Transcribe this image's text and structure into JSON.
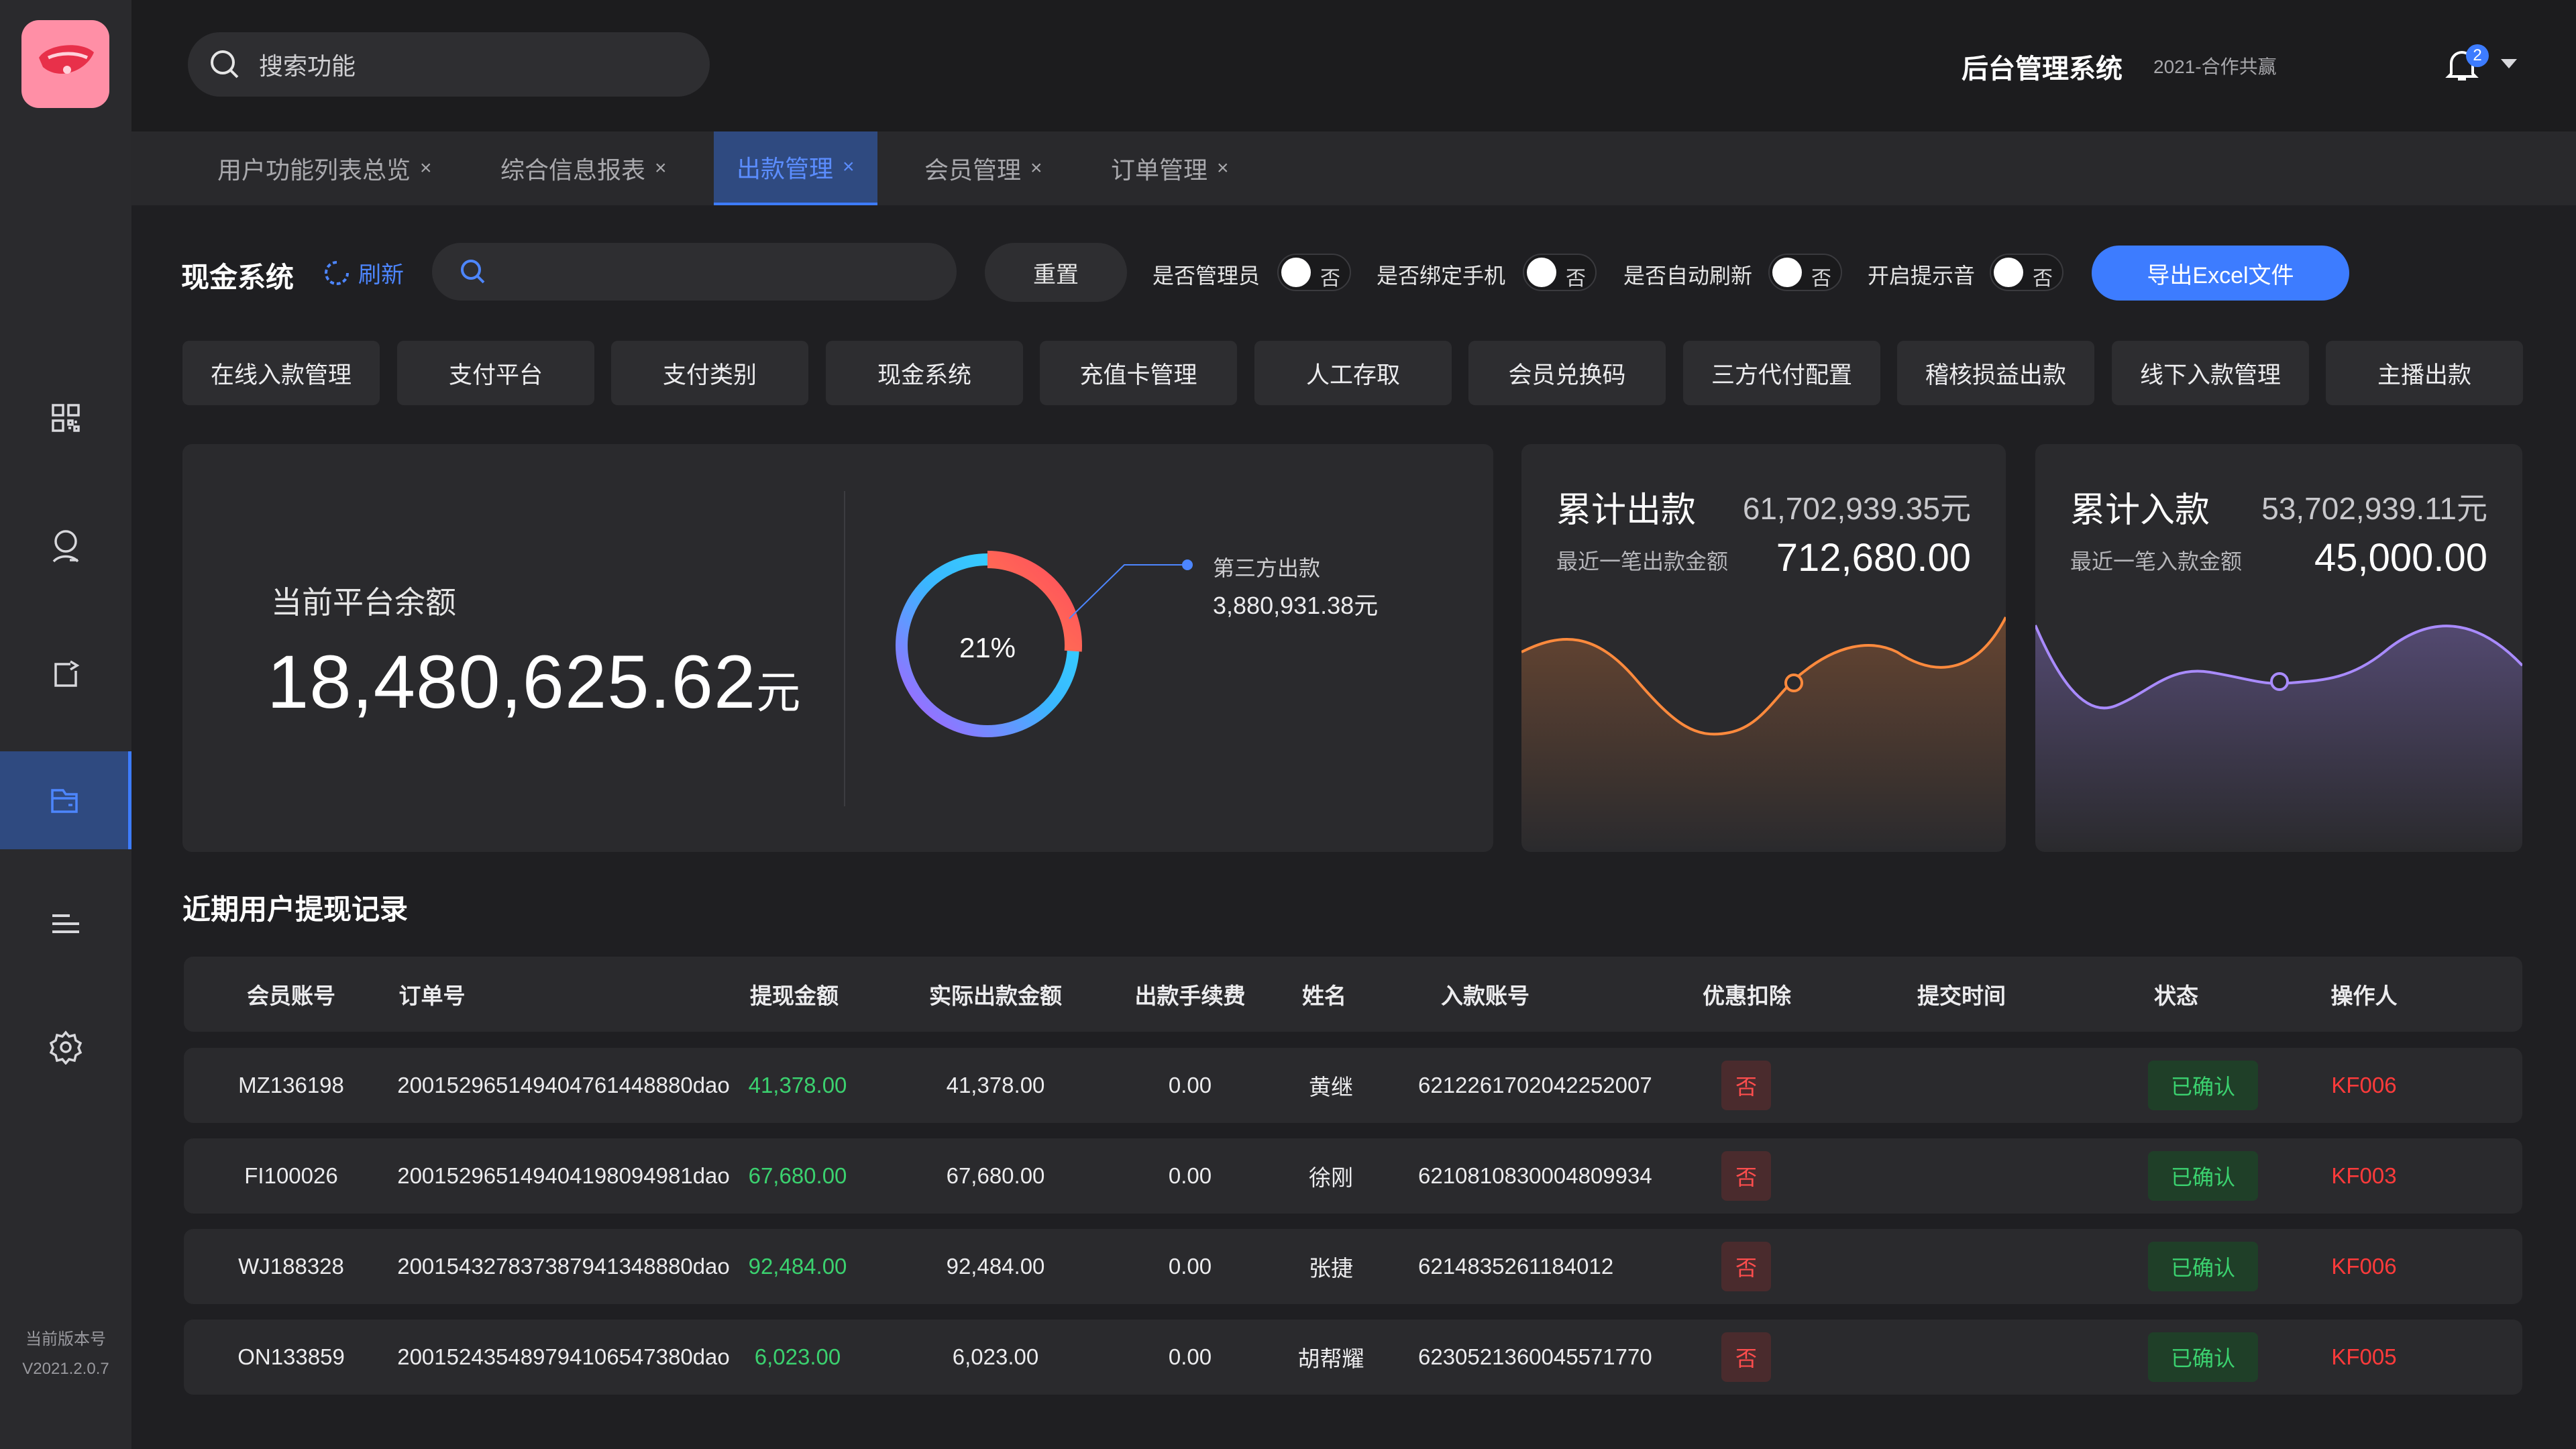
{
  "sidebar": {
    "icons": [
      "grid-icon",
      "user-icon",
      "share-icon",
      "wallet-icon",
      "list-icon",
      "gear-icon"
    ],
    "active_index": 3,
    "version_label": "当前版本号",
    "version_value": "V2021.2.0.7"
  },
  "header": {
    "search_placeholder": "搜索功能",
    "title": "后台管理系统",
    "subtitle": "2021-合作共赢",
    "notification_count": "2"
  },
  "tabs": [
    {
      "label": "用户功能列表总览",
      "active": false
    },
    {
      "label": "综合信息报表",
      "active": false
    },
    {
      "label": "出款管理",
      "active": true
    },
    {
      "label": "会员管理",
      "active": false
    },
    {
      "label": "订单管理",
      "active": false
    }
  ],
  "toolbar": {
    "title": "现金系统",
    "refresh_label": "刷新",
    "reset_label": "重置",
    "toggles": [
      {
        "label": "是否管理员",
        "state": "否"
      },
      {
        "label": "是否绑定手机",
        "state": "否"
      },
      {
        "label": "是否自动刷新",
        "state": "否"
      },
      {
        "label": "开启提示音",
        "state": "否"
      }
    ],
    "export_label": "导出Excel文件"
  },
  "quick_buttons": [
    "在线入款管理",
    "支付平台",
    "支付类别",
    "现金系统",
    "充值卡管理",
    "人工存取",
    "会员兑换码",
    "三方代付配置",
    "稽核损益出款",
    "线下入款管理",
    "主播出款"
  ],
  "balance": {
    "label": "当前平台余额",
    "value": "18,480,625.62",
    "unit": "元",
    "donut_percent": 21,
    "donut_text": "21%",
    "legend_name": "第三方出款",
    "legend_value": "3,880,931.38元"
  },
  "outflow": {
    "title": "累计出款",
    "total": "61,702,939.35元",
    "sub_label": "最近一笔出款金额",
    "last": "712,680.00",
    "color": "#ff8a3d"
  },
  "inflow": {
    "title": "累计入款",
    "total": "53,702,939.11元",
    "sub_label": "最近一笔入款金额",
    "last": "45,000.00",
    "color": "#a98bff"
  },
  "records": {
    "title": "近期用户提现记录",
    "columns": [
      "会员账号",
      "订单号",
      "提现金额",
      "实际出款金额",
      "出款手续费",
      "姓名",
      "入款账号",
      "优惠扣除",
      "提交时间",
      "状态",
      "操作人"
    ],
    "rows": [
      {
        "account": "MZ136198",
        "order": "200152965149404761448880dao",
        "amount": "41,378.00",
        "actual": "41,378.00",
        "fee": "0.00",
        "name": "黄继",
        "bank": "6212261702042252007",
        "discount": "否",
        "time": "",
        "status": "已确认",
        "operator": "KF006"
      },
      {
        "account": "FI100026",
        "order": "200152965149404198094981dao",
        "amount": "67,680.00",
        "actual": "67,680.00",
        "fee": "0.00",
        "name": "徐刚",
        "bank": "6210810830004809934",
        "discount": "否",
        "time": "",
        "status": "已确认",
        "operator": "KF003"
      },
      {
        "account": "WJ188328",
        "order": "200154327837387941348880dao",
        "amount": "92,484.00",
        "actual": "92,484.00",
        "fee": "0.00",
        "name": "张捷",
        "bank": "6214835261184012",
        "discount": "否",
        "time": "",
        "status": "已确认",
        "operator": "KF006"
      },
      {
        "account": "ON133859",
        "order": "200152435489794106547380dao",
        "amount": "6,023.00",
        "actual": "6,023.00",
        "fee": "0.00",
        "name": "胡帮耀",
        "bank": "6230521360045571770",
        "discount": "否",
        "time": "",
        "status": "已确认",
        "operator": "KF005"
      }
    ]
  }
}
